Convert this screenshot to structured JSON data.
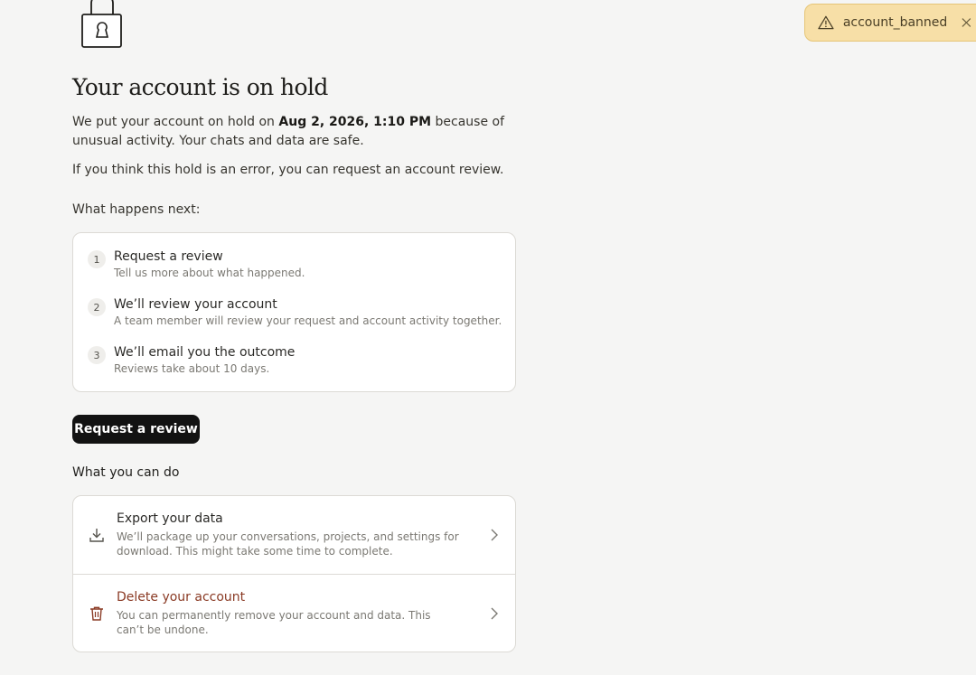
{
  "toast": {
    "icon": "warning-icon",
    "text": "account_banned",
    "close_icon": "close-icon",
    "background": "#f7dfa7"
  },
  "header": {
    "icon": "padlock-icon",
    "title": "Your account is on hold"
  },
  "intro": {
    "p1_before": "We put your account on hold on ",
    "p1_date": "Aug 2, 2026, 1:10 PM",
    "p1_after": " because of unusual activity. Your chats and data are safe.",
    "p2": "If you think this hold is an error, you can request an account review."
  },
  "next": {
    "label": "What happens next:",
    "steps": [
      {
        "num": "1",
        "title": "Request a review",
        "desc": "Tell us more about what happened."
      },
      {
        "num": "2",
        "title": "We’ll review your account",
        "desc": "A team member will review your request and account activity together."
      },
      {
        "num": "3",
        "title": "We’ll email you the outcome",
        "desc": "Reviews take about 10 days."
      }
    ]
  },
  "primary_button": {
    "label": "Request a review",
    "color": "#121212"
  },
  "cando": {
    "label": "What you can do",
    "actions": [
      {
        "icon": "download-icon",
        "title": "Export your data",
        "desc": "We’ll package up your conversations, projects, and settings for download. This might take some time to complete."
      },
      {
        "icon": "trash-icon",
        "title": "Delete your account",
        "desc": "You can permanently remove your account and data. This can’t be undone.",
        "title_color": "#8a3a24"
      }
    ]
  }
}
